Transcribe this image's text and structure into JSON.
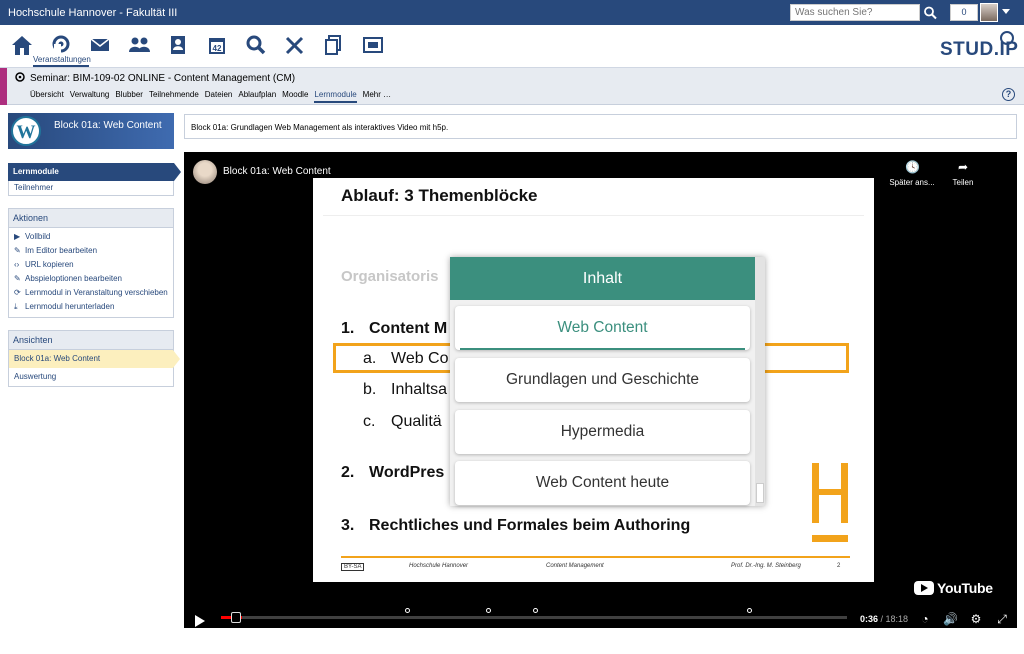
{
  "topbar": {
    "title": "Hochschule Hannover - Fakultät III",
    "search_placeholder": "Was suchen Sie?",
    "notifications": "0"
  },
  "nav": {
    "active_label": "Veranstaltungen",
    "icons": [
      "home-icon",
      "courses-icon",
      "mail-icon",
      "community-icon",
      "profile-icon",
      "calendar-icon",
      "search-icon",
      "tools-icon",
      "files-icon",
      "admin-icon"
    ],
    "logo": "STUD.IP"
  },
  "context": {
    "title": "Seminar: BIM-109-02 ONLINE - Content Management (CM)",
    "tabs": [
      "Übersicht",
      "Verwaltung",
      "Blubber",
      "Teilnehmende",
      "Dateien",
      "Ablaufplan",
      "Moodle",
      "Lernmodule",
      "Mehr …"
    ],
    "active_tab": "Lernmodule",
    "help": "?",
    "stripe_color": "#ad2e7e"
  },
  "sidebar": {
    "module_title": "Block 01a: Web Content",
    "nav_items": [
      "Lernmodule",
      "Teilnehmer"
    ],
    "actions_title": "Aktionen",
    "actions": [
      {
        "icon": "triangle-right-icon",
        "label": "Vollbild"
      },
      {
        "icon": "edit-icon",
        "label": "Im Editor bearbeiten"
      },
      {
        "icon": "code-icon",
        "label": "URL kopieren"
      },
      {
        "icon": "edit-icon",
        "label": "Abspieloptionen bearbeiten"
      },
      {
        "icon": "move-icon",
        "label": "Lernmodul in Veranstaltung verschieben"
      },
      {
        "icon": "download-icon",
        "label": "Lernmodul herunterladen"
      }
    ],
    "views_title": "Ansichten",
    "views": [
      "Block 01a: Web Content",
      "Auswertung"
    ]
  },
  "info": "Block 01a: Grundlagen Web Management als interaktives Video mit h5p.",
  "video": {
    "title": "Block 01a: Web Content",
    "watch_later": "Später ans...",
    "share": "Teilen",
    "time_current": "0:36",
    "time_sep": " / ",
    "time_total": "18:18",
    "progress": 0.033,
    "youtube": "YouTube"
  },
  "slide": {
    "title": "Ablauf: 3 Themenblöcke",
    "faded": "Organisatoris",
    "lines": [
      "1.",
      "Content M",
      "a.",
      "Web Co",
      "b.",
      "Inhaltsa",
      "c.",
      "Qualitä",
      "2.",
      "WordPres",
      "3.",
      "Rechtliches und Formales beim Authoring"
    ],
    "footer_license": "BY-SA",
    "footer_org": "Hochschule Hannover",
    "footer_course": "Content Management",
    "footer_author": "Prof. Dr.-Ing. M. Steinberg",
    "page": "2",
    "accent": "#f2a31b"
  },
  "panel": {
    "header": "Inhalt",
    "items": [
      "Web Content",
      "Grundlagen und Geschichte",
      "Hypermedia",
      "Web Content heute"
    ],
    "accent": "#3b8f7e"
  }
}
